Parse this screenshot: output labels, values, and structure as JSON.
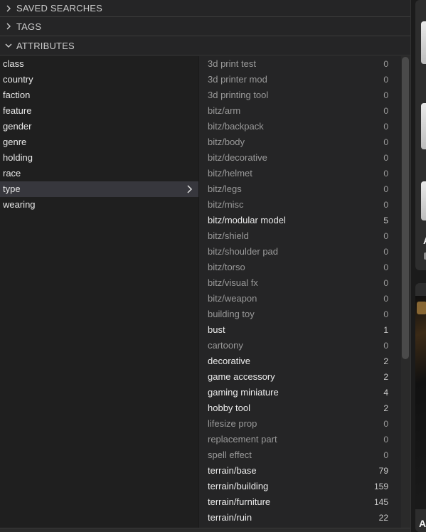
{
  "sections": {
    "saved_searches": "SAVED SEARCHES",
    "tags": "TAGS",
    "attributes": "ATTRIBUTES"
  },
  "attribute_keys": [
    {
      "label": "class"
    },
    {
      "label": "country"
    },
    {
      "label": "faction"
    },
    {
      "label": "feature"
    },
    {
      "label": "gender"
    },
    {
      "label": "genre"
    },
    {
      "label": "holding"
    },
    {
      "label": "race"
    },
    {
      "label": "type",
      "selected": true
    },
    {
      "label": "wearing"
    }
  ],
  "attribute_values": [
    {
      "name": "3d print test",
      "count": "0"
    },
    {
      "name": "3d printer mod",
      "count": "0"
    },
    {
      "name": "3d printing tool",
      "count": "0"
    },
    {
      "name": "bitz/arm",
      "count": "0"
    },
    {
      "name": "bitz/backpack",
      "count": "0"
    },
    {
      "name": "bitz/body",
      "count": "0"
    },
    {
      "name": "bitz/decorative",
      "count": "0"
    },
    {
      "name": "bitz/helmet",
      "count": "0"
    },
    {
      "name": "bitz/legs",
      "count": "0"
    },
    {
      "name": "bitz/misc",
      "count": "0"
    },
    {
      "name": "bitz/modular model",
      "count": "5"
    },
    {
      "name": "bitz/shield",
      "count": "0"
    },
    {
      "name": "bitz/shoulder pad",
      "count": "0"
    },
    {
      "name": "bitz/torso",
      "count": "0"
    },
    {
      "name": "bitz/visual fx",
      "count": "0"
    },
    {
      "name": "bitz/weapon",
      "count": "0"
    },
    {
      "name": "building toy",
      "count": "0"
    },
    {
      "name": "bust",
      "count": "1"
    },
    {
      "name": "cartoony",
      "count": "0"
    },
    {
      "name": "decorative",
      "count": "2"
    },
    {
      "name": "game accessory",
      "count": "2"
    },
    {
      "name": "gaming miniature",
      "count": "4"
    },
    {
      "name": "hobby tool",
      "count": "2"
    },
    {
      "name": "lifesize prop",
      "count": "0"
    },
    {
      "name": "replacement part",
      "count": "0"
    },
    {
      "name": "spell effect",
      "count": "0"
    },
    {
      "name": "terrain/base",
      "count": "79"
    },
    {
      "name": "terrain/building",
      "count": "159"
    },
    {
      "name": "terrain/furniture",
      "count": "145"
    },
    {
      "name": "terrain/ruin",
      "count": "22"
    }
  ],
  "side_cards": {
    "card1_letter": "A",
    "card2_letter": "A"
  },
  "colors": {
    "panel_bg": "#252526",
    "left_bg": "#1f1f1f",
    "selected_bg": "#37373d",
    "active_text": "#ececec",
    "inactive_text": "#9a9a9a"
  },
  "icons": {
    "section_collapsed": "chevron-right-icon",
    "section_expanded": "chevron-down-icon",
    "selected_key": "chevron-right-icon"
  }
}
